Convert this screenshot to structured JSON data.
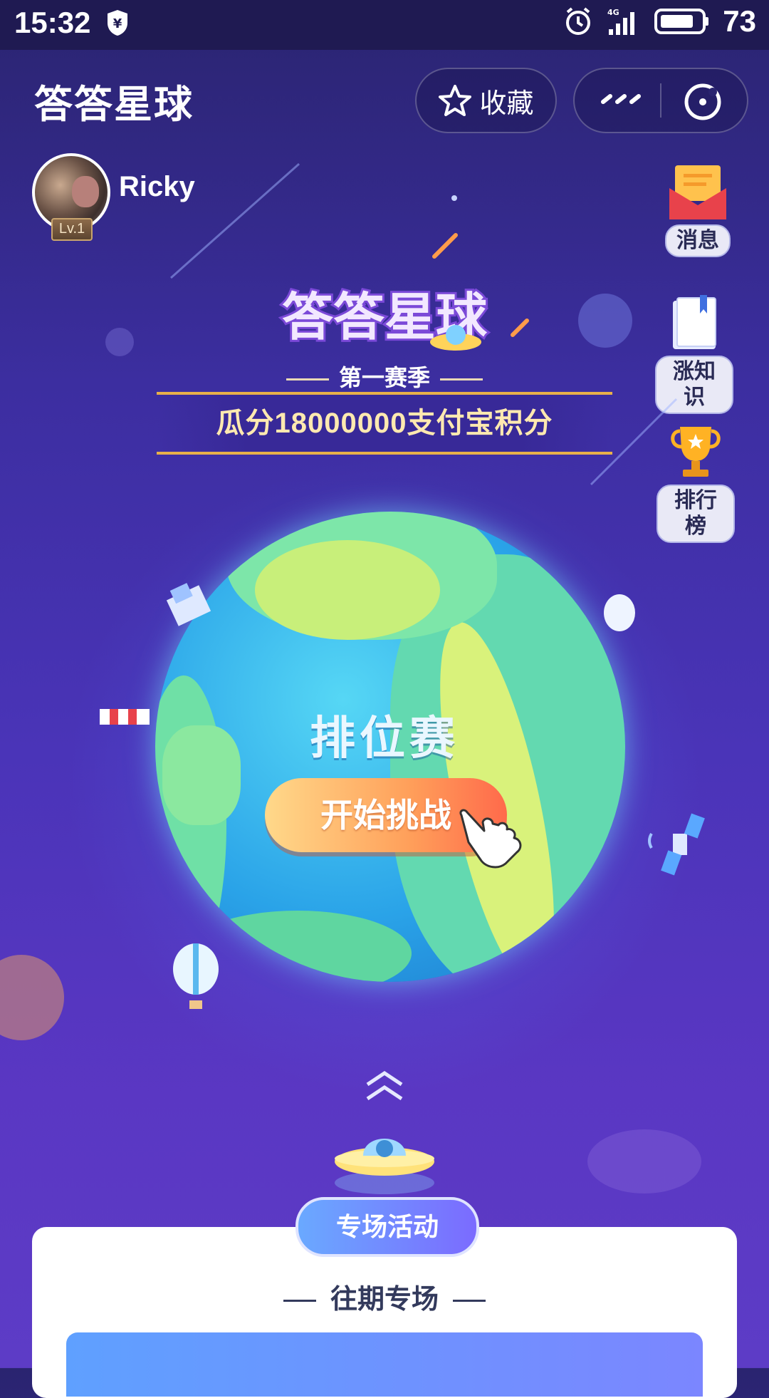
{
  "status_bar": {
    "time": "15:32",
    "battery": "73"
  },
  "header": {
    "title": "答答星球",
    "favorite_label": "收藏"
  },
  "user": {
    "name": "Ricky",
    "level": "Lv.1"
  },
  "side_menu": [
    {
      "label": "消息",
      "icon": "envelope-icon"
    },
    {
      "label": "涨知识",
      "icon": "book-icon"
    },
    {
      "label": "排行榜",
      "icon": "trophy-icon"
    }
  ],
  "hero": {
    "logo_text": "答答星球",
    "season": "第一赛季",
    "prize": "瓜分18000000支付宝积分"
  },
  "game": {
    "mode_title": "排位赛",
    "start_label": "开始挑战"
  },
  "activities": {
    "tab_label": "专场活动",
    "section_title": "往期专场"
  },
  "colors": {
    "background": "#3c2ea0",
    "prize_text": "#ffe9b0",
    "start_button": "#ff8a52"
  }
}
